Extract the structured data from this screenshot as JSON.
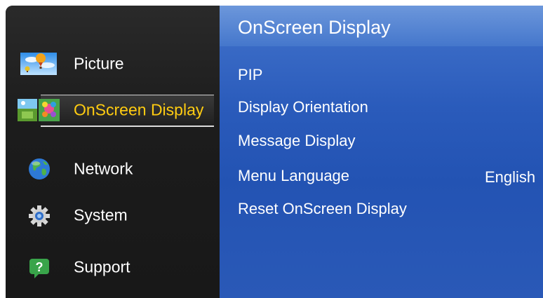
{
  "menu": {
    "items": [
      {
        "label": "Picture",
        "icon": "picture-icon",
        "selected": false
      },
      {
        "label": "OnScreen Display",
        "icon": "onscreen-display-icon",
        "selected": true
      },
      {
        "label": "Network",
        "icon": "network-globe-icon",
        "selected": false
      },
      {
        "label": "System",
        "icon": "system-gear-icon",
        "selected": false
      },
      {
        "label": "Support",
        "icon": "support-question-icon",
        "selected": false
      }
    ],
    "selected_color": "#ffcc11"
  },
  "panel": {
    "title": "OnScreen Display",
    "options": [
      {
        "label": "PIP",
        "value": ""
      },
      {
        "label": "Display Orientation",
        "value": ""
      },
      {
        "label": "Message Display",
        "value": ""
      },
      {
        "label": "Menu Language",
        "value": "English"
      },
      {
        "label": "Reset OnScreen Display",
        "value": ""
      }
    ],
    "background_color": "#2a5bbb"
  }
}
